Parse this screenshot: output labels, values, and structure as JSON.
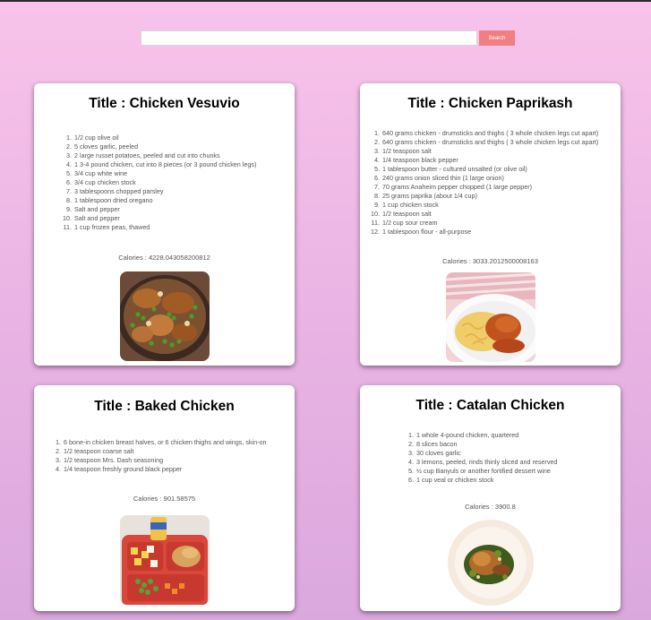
{
  "search": {
    "placeholder": "",
    "value": "",
    "button_label": "Search"
  },
  "recipes": [
    {
      "title": "Title : Chicken Vesuvio",
      "ingredients": [
        "1/2 cup olive oil",
        "5 cloves garlic, peeled",
        "2 large russet potatoes, peeled and cut into chunks",
        "1 3-4 pound chicken, cut into 8 pieces (or 3 pound chicken legs)",
        "3/4 cup white wine",
        "3/4 cup chicken stock",
        "3 tablespoons chopped parsley",
        "1 tablespoon dried oregano",
        "Salt and pepper",
        "Salt and pepper",
        "1 cup frozen peas, thawed"
      ],
      "calories": "Calories : 4228.043058200812",
      "image_icon": "chicken-vesuvio-photo"
    },
    {
      "title": "Title : Chicken Paprikash",
      "ingredients": [
        "640 grams chicken - drumsticks and thighs ( 3 whole chicken legs cut apart)",
        "640 grams chicken - drumsticks and thighs ( 3 whole chicken legs cut apart)",
        "1/2 teaspoon salt",
        "1/4 teaspoon black pepper",
        "1 tablespoon butter - cultured unsalted (or olive oil)",
        "240 grams onion sliced thin (1 large onion)",
        "70 grams Anaheim pepper chopped (1 large pepper)",
        "25 grams paprika (about 1/4 cup)",
        "1 cup chicken stock",
        "1/2 teaspoon salt",
        "1/2 cup sour cream",
        "1 tablespoon flour - all-purpose"
      ],
      "calories": "Calories : 3033.2012500008163",
      "image_icon": "chicken-paprikash-photo"
    },
    {
      "title": "Title : Baked Chicken",
      "ingredients": [
        "6 bone-in chicken breast halves, or 6 chicken thighs and wings, skin-on",
        "1/2 teaspoon coarse salt",
        "1/2 teaspoon Mrs. Dash seasoning",
        "1/4 teaspoon freshly ground black pepper"
      ],
      "calories": "Calories : 901.58575",
      "image_icon": "baked-chicken-photo"
    },
    {
      "title": "Title : Catalan Chicken",
      "ingredients": [
        "1 whole 4-pound chicken, quartered",
        "8 slices bacon",
        "30 cloves garlic",
        "3 lemons, peeled, rinds thinly sliced and reserved",
        "½ cup Banyuls or another fortified dessert wine",
        "1 cup veal or chicken stock"
      ],
      "calories": "Calories : 3900.8",
      "image_icon": "catalan-chicken-photo"
    }
  ],
  "colors": {
    "background_top": "#f8c3ea",
    "background_bottom": "#dba8de",
    "search_button": "#ef7f82",
    "card": "#ffffff"
  }
}
